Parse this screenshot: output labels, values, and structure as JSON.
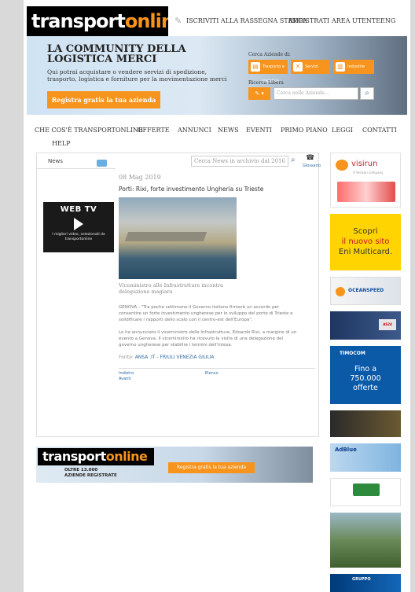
{
  "header": {
    "logo_primary": "transport",
    "logo_accent": "online",
    "top_links": [
      "ISCRIVITI ALLA RASSEGNA STAMPA",
      "REGISTRATI",
      "AREA UTENTE",
      "ENG"
    ]
  },
  "banner": {
    "title": "LA COMMUNITY DELLA LOGISTICA MERCI",
    "subtitle": "Qui potrai acquistare o vendere servizi di spedizione, trasporto, logistica e forniture per la movimentazione merci",
    "register_button": "Registra gratis la tua azienda",
    "search_companies_label": "Cerca Aziende di:",
    "chips": [
      "Trasporto e logistica",
      "Servizi",
      "Industrie"
    ],
    "free_search_label": "Ricerca Libera",
    "free_search_placeholder": "Cerca nelle Aziende..."
  },
  "nav": {
    "items": [
      "CHE COS'È TRANSPORTONLINE",
      "OFFERTE",
      "ANNUNCI",
      "NEWS",
      "EVENTI",
      "PRIMO PIANO",
      "LEGGI",
      "CONTATTI",
      "HELP"
    ]
  },
  "content": {
    "tab_label": "News",
    "search_placeholder": "Cerca News in archivio dal 2016",
    "rss_label": "Glossario",
    "webtv": {
      "title": "WEB TV",
      "subtitle": "I migliori video, selezionati da transportonline"
    },
    "article": {
      "date": "08 Mag 2019",
      "title": "Porti: Rixi, forte investimento Ungheria su Trieste",
      "caption": "Viceministro alle Infrastrutture incontra delegazione magiara",
      "paragraphs": [
        "GENOVA - \"Tra poche settimane il Governo italiano firmerà un accordo per consentire un forte investimento ungherese per lo sviluppo del porto di Trieste e solidificare i rapporti dello scalo con il centro-est dell'Europa\".",
        "Lo ha annunciato il viceministro delle Infrastrutture, Edoardo Rixi, a margine di un evento a Genova. Il viceministro ha ricevuto la visita di una delegazione del governo ungherese per stabilire i termini dell'intesa."
      ],
      "source_label": "Fonte:",
      "source": "ANSA .IT - FRIULI VENEZIA GIULIA",
      "links": [
        "Indietro",
        "Avanti",
        "Elenco"
      ]
    }
  },
  "bottom_banner": {
    "logo_primary": "transport",
    "logo_accent": "online",
    "sub_line1": "OLTRE 13.000",
    "sub_line2": "AZIENDE REGISTRATE",
    "button": "Registra gratis la tua azienda"
  },
  "ads": {
    "visirun_name": "visirun",
    "visirun_tag": "A Verizon company",
    "eni_line1": "Scopri",
    "eni_line2": "il nuovo sito",
    "eni_line3": "Eni Multicard.",
    "ocean_name": "OCEANSPEED",
    "truck_badge": "AS24",
    "timocom_brand": "TIMOCOM",
    "timocom_line1": "Fino a",
    "timocom_line2": "750.000",
    "timocom_line3": "offerte",
    "adblue_name": "AdBlue",
    "group_name": "GRUPPO"
  }
}
